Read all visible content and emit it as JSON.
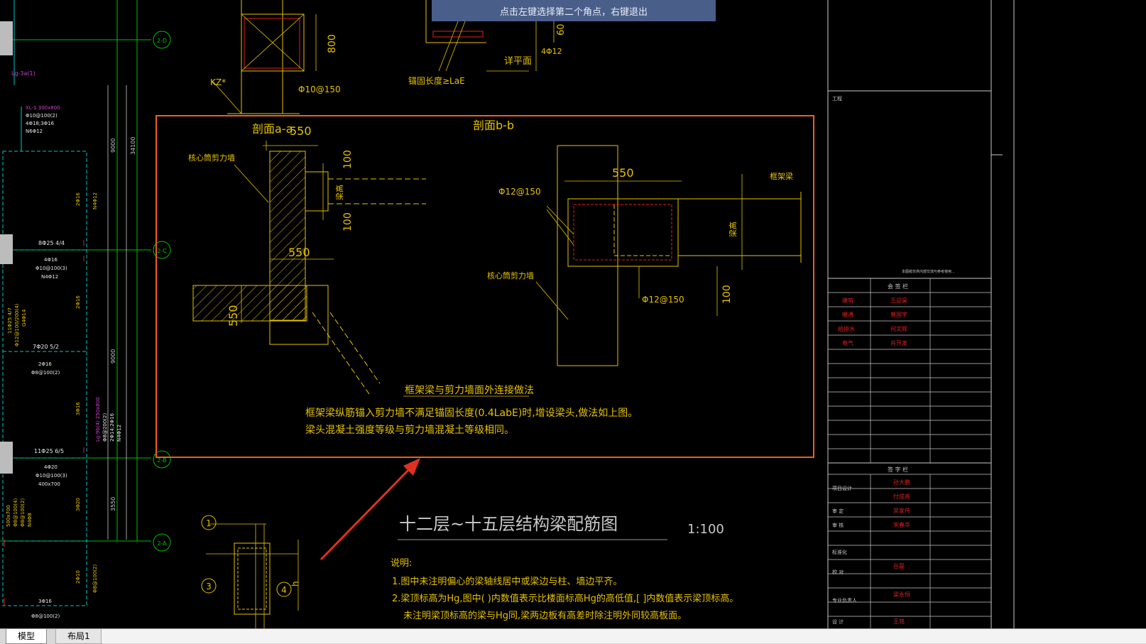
{
  "app": {
    "command_prompt": "点击左键选择第二个角点，右键退出"
  },
  "tabs": [
    {
      "label": "模型"
    },
    {
      "label": "布局1"
    }
  ],
  "drawing": {
    "axis_labels": {
      "d": "2-D",
      "c": "2-C",
      "b": "2-B",
      "a": "2-A"
    },
    "left_strip": {
      "lg_tag": "Lg-3a(1)",
      "xl1_lines": [
        "XL-1 300x800",
        "Φ10@100(2)",
        "4Φ18;3Φ16",
        "N6Φ12"
      ],
      "dim_9000_top": "9000",
      "dim_34100": "34100",
      "dim_9000_mid": "9000",
      "dim_3550": "3550",
      "beam_notes": [
        "8Φ25 4/4",
        "4Φ16",
        "Φ10@100(3)",
        "N4Φ12",
        "7Φ20 5/2",
        "2Φ16",
        "Φ8@100(2)",
        "11Φ25 6/5",
        "4Φ20",
        "Φ10@100(3)",
        "400x700",
        "3Φ16",
        "Φ8@100(2)"
      ],
      "vertical_notes": [
        "2Φ16",
        "N4Φ12",
        "2Φ16",
        "3Φ16",
        "3Φ20",
        "2Φ10",
        "Φ8@100(2)",
        "11Φ25 4/7",
        "Φ12@100/200(4)",
        "G4Φ14",
        "Lg-9b(4) 250x800",
        "Φ8@200(2)",
        "2Φ14;2Φ16",
        "N4Φ12",
        "500x700",
        "Φ8@100(4)",
        "N4Φ8",
        "Φ8@100(2)"
      ]
    },
    "top_detail": {
      "dim_800": "800",
      "kz": "KZ*",
      "stirrup": "Φ10@150",
      "anchor": "锚固长度≥LaE",
      "plan_ref": "详平面",
      "rebar_4012": "4Φ12",
      "dim_60": "60"
    },
    "section_a": {
      "title": "剖面a-a",
      "dim_550_top": "550",
      "wall_label": "核心筒剪力墙",
      "dim_100_a": "100",
      "beam_h": "梁高",
      "dim_100_b": "100",
      "dim_550_mid": "550",
      "dim_550_low": "550"
    },
    "section_b": {
      "title": "剖面b-b",
      "dim_550": "550",
      "frame_beam": "框架梁",
      "rebar_top": "Φ12@150",
      "beam_h": "梁高",
      "wall_label": "核心筒剪力墙",
      "rebar_bottom": "Φ12@150",
      "dim_100": "100"
    },
    "note": {
      "title": "框架梁与剪力墙面外连接做法",
      "line1": "框架梁纵筋锚入剪力墙不满足锚固长度(0.4LabE)时,增设梁头,做法如上图。",
      "line2": "梁头混凝土强度等级与剪力墙混凝土等级相同。"
    },
    "main_title": "十二层~十五层结构梁配筋图",
    "scale": "1:100",
    "explanation": {
      "heading": "说明:",
      "item1": "1.图中未注明偏心的梁轴线居中或梁边与柱、墙边平齐。",
      "item2": "2.梁顶标高为Hg,图中( )内数值表示比楼面标高Hg的高低值,[ ]内数值表示梁顶标高。",
      "item3": "未注明梁顶标高的梁与Hg同,梁两边板有高差时除注明外同较高板面。"
    },
    "small_section": {
      "mark1": "1",
      "mark3": "3",
      "mark4": "4",
      "mark_h": "h"
    }
  },
  "title_block": {
    "project_label": "工程",
    "sheet_label": "本图纸仅供内部交流与参考使用...",
    "cosign_header": "会 签 栏",
    "cosign": [
      {
        "role": "建筑",
        "name": "王迎昊"
      },
      {
        "role": "暖通",
        "name": "曾国宇"
      },
      {
        "role": "给排水",
        "name": "何文辉"
      },
      {
        "role": "电气",
        "name": "肖开发"
      }
    ],
    "sign_header": "签 字 栏",
    "signs": [
      {
        "role": "项目设计",
        "name": "孙大鹏"
      },
      {
        "role": "",
        "name": "付成亮"
      },
      {
        "role": "审 定",
        "name": "吴家伟"
      },
      {
        "role": "审 核",
        "name": "宋春华"
      },
      {
        "role": "标准化",
        "name": ""
      },
      {
        "role": "校 对",
        "name": "岳磊"
      },
      {
        "role": "专业负责人",
        "name": "梁永恒"
      },
      {
        "role": "设 计",
        "name": "王铭"
      }
    ]
  },
  "colors": {
    "background": "#000000",
    "yellow": "#e6c200",
    "orange_frame": "#e8621c",
    "green": "#00c000",
    "cyan": "#00c8c8",
    "red": "#e02020",
    "white": "#e8e8e8",
    "arrow": "#e03020"
  }
}
